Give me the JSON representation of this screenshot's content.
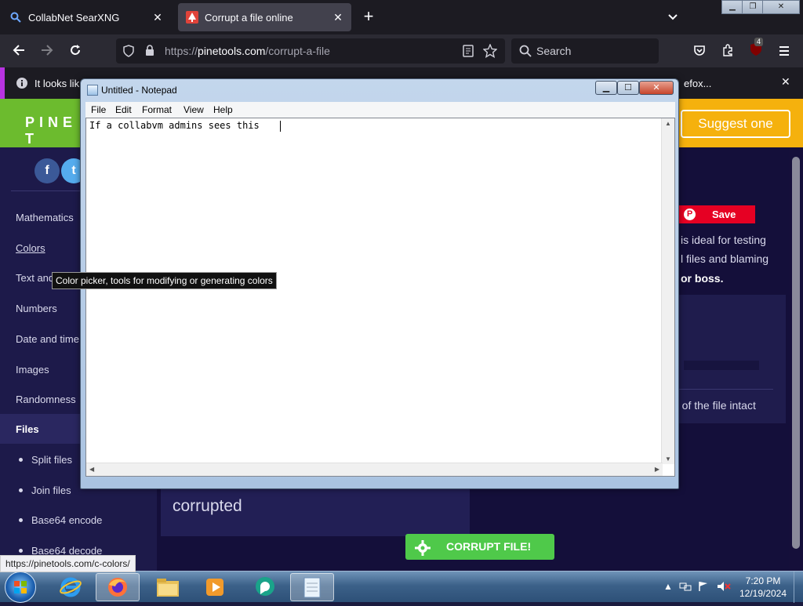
{
  "browser": {
    "tabs": [
      {
        "label": "CollabNet SearXNG",
        "active": false
      },
      {
        "label": "Corrupt a file online",
        "active": true
      }
    ],
    "url": {
      "scheme": "https://",
      "host": "pinetools.com",
      "path": "/corrupt-a-file"
    },
    "search_placeholder": "Search",
    "extension_badge": "4",
    "notification": {
      "text_start": "It looks lik",
      "text_end": "efox..."
    }
  },
  "page": {
    "logo": "PINE T",
    "suggest_button": "Suggest one",
    "sidebar": {
      "categories": [
        "Mathematics",
        "Colors",
        "Text and",
        "Numbers",
        "Date and time",
        "Images",
        "Randomness",
        "Files"
      ],
      "file_tools": [
        "Split files",
        "Join files",
        "Base64 encode",
        "Base64 decode"
      ]
    },
    "pinterest_save": "Save",
    "right_text": [
      "is ideal for testing",
      "l files and blaming",
      "or boss."
    ],
    "panel_text": "d of the file intact",
    "corrupted_label": "corrupted",
    "corrupt_button": "CORRUPT FILE!"
  },
  "tooltip": "Color picker, tools for modifying or generating colors",
  "status_url": "https://pinetools.com/c-colors/",
  "notepad": {
    "title": "Untitled - Notepad",
    "menu": [
      "File",
      "Edit",
      "Format",
      "View",
      "Help"
    ],
    "content": "If a collabvm admins sees this"
  },
  "taskbar": {
    "time": "7:20 PM",
    "date": "12/19/2024"
  },
  "colors": {
    "brand_green": "#6cbb2e",
    "brand_yellow": "#f5b10d",
    "page_bg": "#140f3a",
    "corrupt_button": "#4fc94a"
  }
}
